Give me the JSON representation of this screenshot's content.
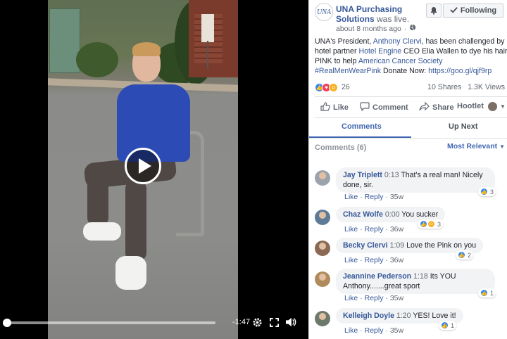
{
  "video": {
    "time_remaining": "-1:47",
    "progress": 0.02,
    "icons": [
      "play-icon",
      "gear-icon",
      "fullscreen-icon",
      "expand-icon",
      "volume-icon"
    ]
  },
  "page": {
    "avatar_text": "UNA",
    "name": "UNA Purchasing Solutions",
    "status": "was live.",
    "time": "about 8 months ago",
    "privacy_icon": "globe-icon",
    "following_label": "Following"
  },
  "post": {
    "t1": "UNA's President, ",
    "person": "Anthony Clervi",
    "t2": ", has been challenged by hotel partner ",
    "partner": "Hotel Engine",
    "t3": " CEO Elia Wallen to dye his hair PINK to help ",
    "charity": "American Cancer Society",
    "t4": " ",
    "hashtag": "#RealMenWearPink",
    "t5": " Donate Now: ",
    "url": "https://goo.gl/qjf9rp"
  },
  "stats": {
    "reactions": "26",
    "shares": "10 Shares",
    "views": "1.3K Views"
  },
  "actions": {
    "like": "Like",
    "comment": "Comment",
    "share": "Share",
    "hootlet": "Hootlet"
  },
  "tabs": {
    "comments": "Comments",
    "up_next": "Up Next"
  },
  "comments_header": {
    "label": "Comments (6)",
    "sort": "Most Relevant"
  },
  "comments": [
    {
      "name": "Jay Triplett",
      "ts": "0:13",
      "line1": "That's a real man! Nicely",
      "line2": "done, sir.",
      "like": "Like",
      "reply": "Reply",
      "age": "35w",
      "reacts": "3"
    },
    {
      "name": "Chaz Wolfe",
      "ts": "0:00",
      "line1": "You sucker",
      "like": "Like",
      "reply": "Reply",
      "age": "36w",
      "reacts": "3"
    },
    {
      "name": "Becky Clervi",
      "ts": "1:09",
      "line1": "Love the Pink on you",
      "like": "Like",
      "reply": "Reply",
      "age": "36w",
      "reacts": "2"
    },
    {
      "name": "Jeannine Pederson",
      "ts": "1:18",
      "line1": "Its YOU",
      "line2": "Anthony.......great sport",
      "like": "Like",
      "reply": "Reply",
      "age": "35w",
      "reacts": "1"
    },
    {
      "name": "Kelleigh Doyle",
      "ts": "1:20",
      "line1": "YES! Love it!",
      "like": "Like",
      "reply": "Reply",
      "age": "35w",
      "reacts": "1"
    }
  ],
  "colors": {
    "link": "#365899",
    "accent": "#4267b2",
    "bubble": "#f2f3f5",
    "meta": "#606770"
  }
}
